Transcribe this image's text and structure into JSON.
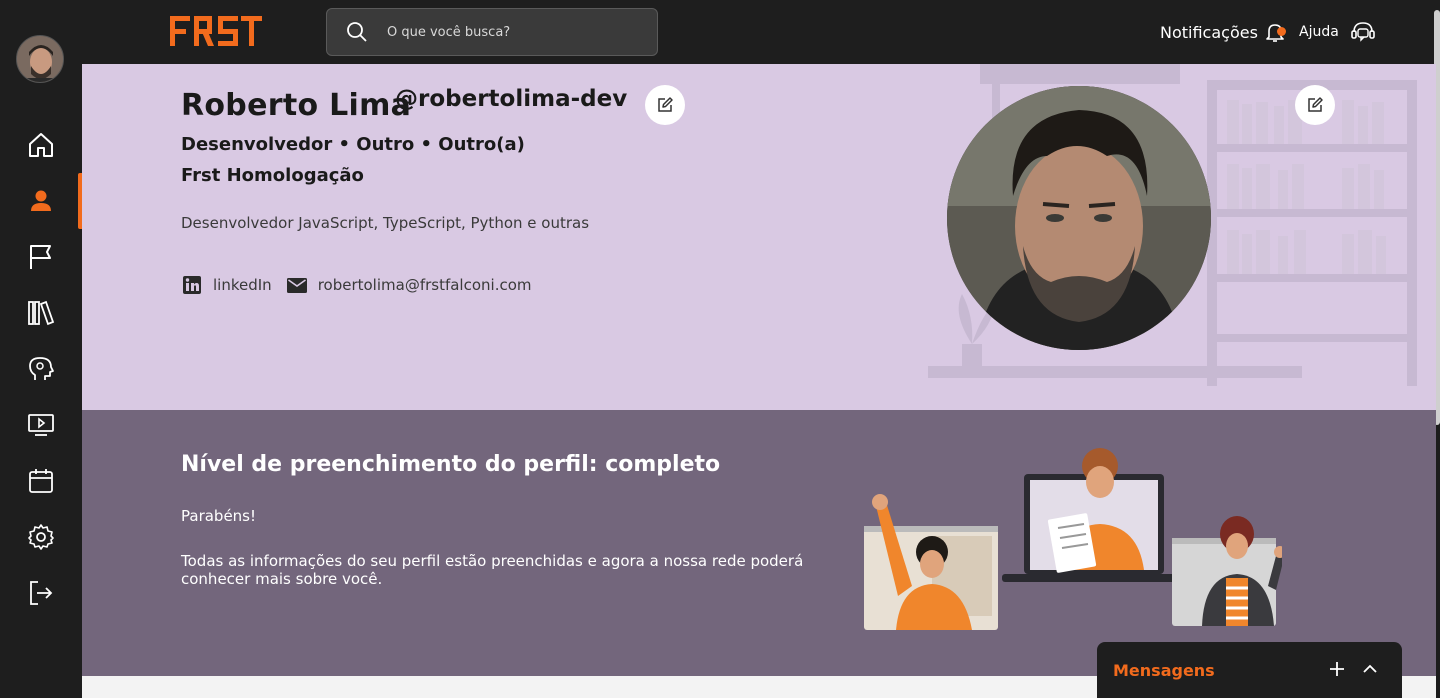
{
  "brand": {
    "logo_text": "FRST",
    "accent": "#f26b1d"
  },
  "search": {
    "placeholder": "O que você busca?"
  },
  "header": {
    "notifications_label": "Notificações",
    "help_label": "Ajuda"
  },
  "sidebar": {
    "items": [
      {
        "name": "home",
        "icon": "home-icon"
      },
      {
        "name": "profile",
        "icon": "user-icon",
        "active": true
      },
      {
        "name": "goals",
        "icon": "flag-icon"
      },
      {
        "name": "library",
        "icon": "books-icon"
      },
      {
        "name": "mind",
        "icon": "brain-head-icon"
      },
      {
        "name": "videos",
        "icon": "play-screen-icon"
      },
      {
        "name": "calendar",
        "icon": "calendar-icon"
      },
      {
        "name": "settings",
        "icon": "gear-icon"
      },
      {
        "name": "logout",
        "icon": "logout-icon"
      }
    ]
  },
  "profile": {
    "name": "Roberto Lima",
    "handle": "@robertolima-dev",
    "role": "Desenvolvedor • Outro • Outro(a)",
    "company": "Frst Homologação",
    "bio": "Desenvolvedor JavaScript, TypeScript, Python e outras",
    "linkedin_label": "linkedIn",
    "email": "robertolima@frstfalconi.com"
  },
  "completion": {
    "title": "Nível de preenchimento do perfil: completo",
    "congrats": "Parabéns!",
    "message": "Todas as informações do seu perfil estão preenchidas e agora a nossa rede poderá conhecer mais sobre você."
  },
  "messages": {
    "title": "Mensagens"
  }
}
